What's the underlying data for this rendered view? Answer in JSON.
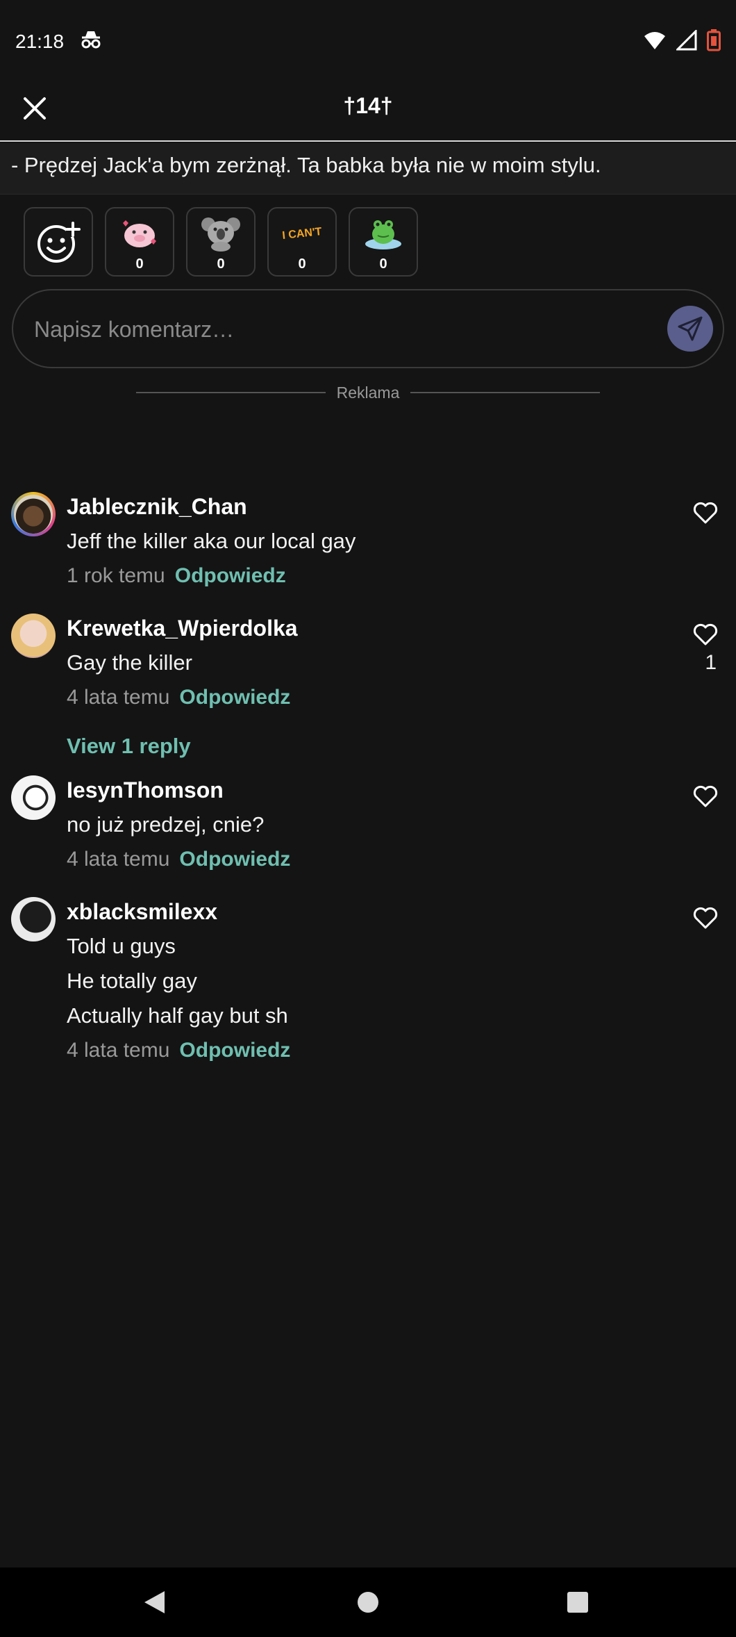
{
  "status_bar": {
    "time": "21:18",
    "icons": [
      "incognito-icon",
      "wifi-icon",
      "signal-icon",
      "battery-icon"
    ]
  },
  "header": {
    "title": "†14†"
  },
  "quote": {
    "text": "- Prędzej Jack'a bym zerżnął. Ta babka była nie w moim stylu."
  },
  "reactions": [
    {
      "name": "pig-sticker",
      "count": "0"
    },
    {
      "name": "koala-sticker",
      "count": "0"
    },
    {
      "name": "i-cant-sticker",
      "count": "0"
    },
    {
      "name": "frog-sticker",
      "count": "0"
    }
  ],
  "comment_input": {
    "placeholder": "Napisz komentarz…"
  },
  "ad": {
    "label": "Reklama"
  },
  "comments": [
    {
      "user": "Jablecznik_Chan",
      "lines": [
        "Jeff the killer aka our local gay"
      ],
      "time": "1 rok temu",
      "reply_label": "Odpowiedz",
      "likes": ""
    },
    {
      "user": "Krewetka_Wpierdolka",
      "lines": [
        "Gay the killer"
      ],
      "time": "4 lata temu",
      "reply_label": "Odpowiedz",
      "likes": "1"
    },
    {
      "user": "IesynThomson",
      "lines": [
        "no już predzej, cnie?"
      ],
      "time": "4 lata temu",
      "reply_label": "Odpowiedz",
      "likes": ""
    },
    {
      "user": "xblacksmilexx",
      "lines": [
        "Told u guys",
        "He totally gay",
        "Actually half gay but sh"
      ],
      "time": "4 lata temu",
      "reply_label": "Odpowiedz",
      "likes": ""
    }
  ],
  "view_reply_label": "View 1 reply",
  "colors": {
    "background": "#141414",
    "accent_reply": "#6fbfb0",
    "send_button": "#5a5e8c",
    "battery": "#e5533d"
  }
}
